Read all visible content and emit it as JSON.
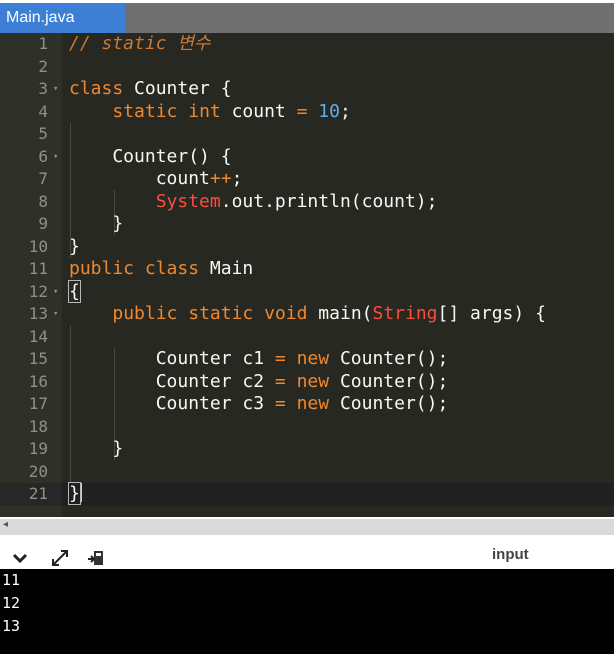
{
  "tab": {
    "label": "Main.java"
  },
  "editor": {
    "lines": [
      {
        "num": "1"
      },
      {
        "num": "2"
      },
      {
        "num": "3",
        "fold": true
      },
      {
        "num": "4"
      },
      {
        "num": "5"
      },
      {
        "num": "6",
        "fold": true
      },
      {
        "num": "7"
      },
      {
        "num": "8"
      },
      {
        "num": "9"
      },
      {
        "num": "10"
      },
      {
        "num": "11"
      },
      {
        "num": "12",
        "fold": true
      },
      {
        "num": "13",
        "fold": true
      },
      {
        "num": "14"
      },
      {
        "num": "15"
      },
      {
        "num": "16"
      },
      {
        "num": "17"
      },
      {
        "num": "18"
      },
      {
        "num": "19"
      },
      {
        "num": "20"
      },
      {
        "num": "21"
      }
    ],
    "code": {
      "l1_comment": "// static 변수",
      "l3_class": "class",
      "l3_rest": " Counter {",
      "l4_indent": "    ",
      "l4_static": "static",
      "l4_int": "int",
      "l4_var": " count ",
      "l4_eq": "=",
      "l4_num": "10",
      "l4_end": ";",
      "l6_text": "    Counter() {",
      "l7_indent": "        count",
      "l7_op": "++",
      "l7_end": ";",
      "l8_indent": "        ",
      "l8_system": "System",
      "l8_rest": ".out.println(count);",
      "l9_text": "    }",
      "l10_text": "}",
      "l11_public": "public",
      "l11_class": "class",
      "l11_name": " Main",
      "l12_brace": "{",
      "l13_indent": "    ",
      "l13_public": "public",
      "l13_static": "static",
      "l13_void": "void",
      "l13_main": " main(",
      "l13_string": "String",
      "l13_rest": "[] args) {",
      "l15_a": "        Counter c1 ",
      "l15_eq": "=",
      "l15_new": "new",
      "l15_b": " Counter();",
      "l16_a": "        Counter c2 ",
      "l16_eq": "=",
      "l16_new": "new",
      "l16_b": " Counter();",
      "l17_a": "        Counter c3 ",
      "l17_eq": "=",
      "l17_new": "new",
      "l17_b": " Counter();",
      "l19_text": "    }",
      "l21_brace": "}"
    }
  },
  "console": {
    "input_label": "input",
    "icons": [
      "chevron-down-icon",
      "expand-icon",
      "clear-output-icon"
    ],
    "output": [
      "11",
      "12",
      "13"
    ]
  },
  "colors": {
    "tab_active": "#3c7fd4",
    "editor_bg": "#272822",
    "keyword": "#f0882f",
    "number": "#66aaee",
    "class_ref": "#ff4c3b",
    "cursor": "#aaff33",
    "output_bg": "#000000"
  }
}
